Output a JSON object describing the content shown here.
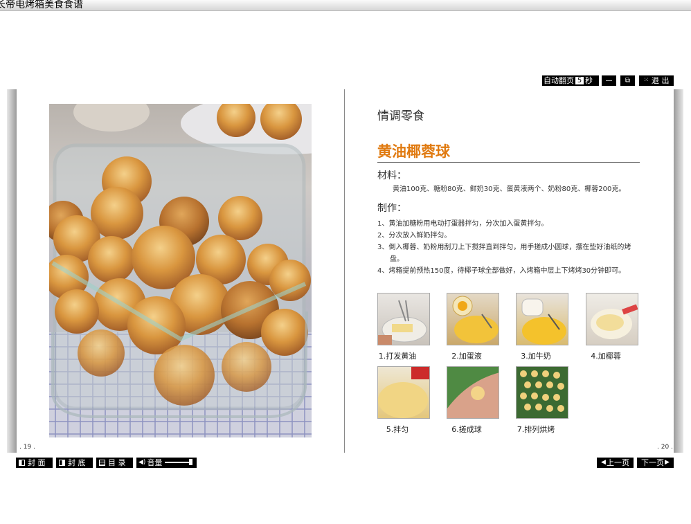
{
  "window": {
    "title": "长帝电烤箱美食食谱"
  },
  "topbar": {
    "autoflip_label": "自动翻页",
    "seconds_value": "5",
    "seconds_unit": "秒",
    "minimize_label": "—",
    "restore_label": "⧉",
    "exit_label": "退 出"
  },
  "left_page": {
    "page_number": ". 19 ."
  },
  "right_page": {
    "page_number": ". 20 .",
    "category": "情调零食",
    "title": "黄油椰蓉球",
    "materials_heading": "材料：",
    "materials": "黄油100克、糖粉80克、鲜奶30克、蛋黄液两个、奶粉80克、椰蓉200克。",
    "method_heading": "制作：",
    "steps": [
      "1、黄油加糖粉用电动打蛋器拌匀，分次加入蛋黄拌匀。",
      "2、分次放入鲜奶拌匀。",
      "3、倒入椰蓉、奶粉用刮刀上下搅拌直到拌匀，用手搓成小圆球，摆在垫好油纸的烤盘。",
      "4、烤箱提前预热150度，待椰子球全部做好，入烤箱中层上下烤烤30分钟即可。"
    ],
    "step_photos": [
      {
        "caption": "1.打发黄油"
      },
      {
        "caption": "2.加蛋液"
      },
      {
        "caption": "3.加牛奶"
      },
      {
        "caption": "4.加椰蓉"
      },
      {
        "caption": "5.拌匀"
      },
      {
        "caption": "6.搓成球"
      },
      {
        "caption": "7.排列烘烤"
      }
    ]
  },
  "bottombar": {
    "front_cover": "封 面",
    "back_cover": "封 底",
    "contents": "目 录",
    "volume": "音量",
    "prev_page": "上一页",
    "next_page": "下一页"
  }
}
